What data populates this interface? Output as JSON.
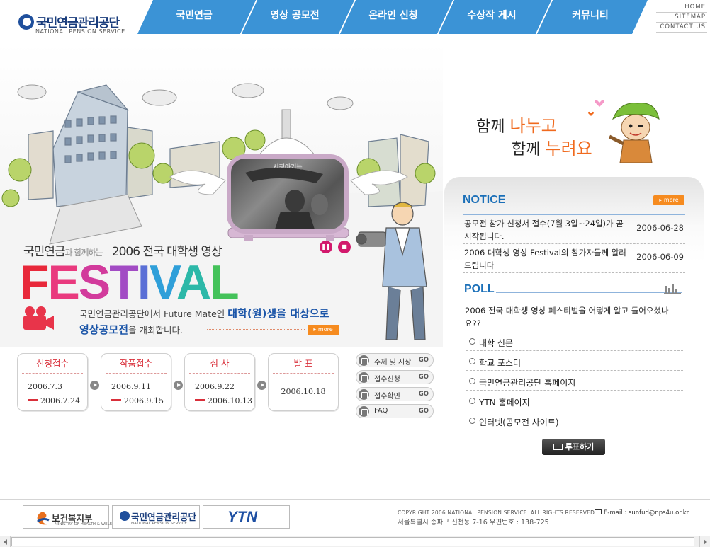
{
  "header": {
    "logo_ko": "국민연금관리공단",
    "logo_en": "NATIONAL PENSION SERVICE",
    "nav": [
      "국민연금",
      "영상 공모전",
      "온라인 신청",
      "수상작 게시",
      "커뮤니티"
    ],
    "util": [
      "HOME",
      "SITEMAP",
      "CONTACT US"
    ]
  },
  "hero": {
    "tv_caption": "시청아기는",
    "headline_part1": "국민연금",
    "headline_hand": "과 함께하는",
    "headline_part2": "2006 전국 대학생 영상",
    "festival_letters": [
      "F",
      "E",
      "S",
      "T",
      "I",
      "V",
      "A",
      "L"
    ],
    "festival_colors": [
      "#e8283a",
      "#e93a7e",
      "#d23b9c",
      "#a24bc4",
      "#5a6fd6",
      "#2f9fd9",
      "#2cb8a8",
      "#44c25a"
    ],
    "desc_line1_a": "국민연금관리공단에서 Future Mate인 ",
    "desc_line1_b": "대학(원)생을 대상으로",
    "desc_line2_a": "영상공모전",
    "desc_line2_b": "을 개최합니다.",
    "more_label": "more"
  },
  "steps": [
    {
      "title": "신청접수",
      "start": "2006.7.3",
      "end": "2006.7.24"
    },
    {
      "title": "작품접수",
      "start": "2006.9.11",
      "end": "2006.9.15"
    },
    {
      "title": "심 사",
      "start": "2006.9.22",
      "end": "2006.10.13"
    },
    {
      "title": "발 표",
      "date": "2006.10.18"
    }
  ],
  "quick": [
    {
      "label": "주제 및 시상",
      "go": "GO",
      "icon": "award-icon"
    },
    {
      "label": "접수신청",
      "go": "GO",
      "icon": "document-icon"
    },
    {
      "label": "접수확인",
      "go": "GO",
      "icon": "check-icon"
    },
    {
      "label": "FAQ",
      "go": "GO",
      "icon": "speech-bubble-icon"
    }
  ],
  "slogan": {
    "line1_a": "함께 ",
    "line1_b": "나누고",
    "line2_a": "함께 ",
    "line2_b": "누려요"
  },
  "notice": {
    "heading": "NOTICE",
    "more": "more",
    "items": [
      {
        "title": "공모전 참가 신청서 접수(7월 3일~24일)가 곧 시작됩니다.",
        "date": "2006-06-28"
      },
      {
        "title": "2006 대학생 영상 Festival의 참가자들께 알려드립니다",
        "date": "2006-06-09"
      }
    ]
  },
  "poll": {
    "heading": "POLL",
    "question": "2006 전국 대학생 영상 페스티벌을 어떻게 알고 들어오셨나요??",
    "options": [
      "대학 신문",
      "학교 포스터",
      "국민연금관리공단 홈페이지",
      "YTN 홈페이지",
      "인터넷(공모전 사이트)"
    ],
    "vote": "투표하기"
  },
  "footer": {
    "logos": [
      {
        "text": "보건복지부",
        "sub": "MINISTRY OF HEALTH & WELFARE"
      },
      {
        "text": "국민연금관리공단",
        "sub": "NATIONAL PENSION SERVICE"
      },
      {
        "text": "YTN",
        "sub": ""
      }
    ],
    "copyright": "COPYRIGHT 2006 NATIONAL PENSION SERVICE. ALL RIGHTS RESERVED.",
    "email": "E-mail : sunfud@nps4u.or.kr",
    "address": "서울특별시 송파구 신천동 7-16   우편번호 : 138-725"
  },
  "colors": {
    "nav_blue": "#3b93d6",
    "accent_orange": "#f68b1f",
    "heading_blue": "#1a6fb8",
    "step_red": "#d92f3a"
  }
}
